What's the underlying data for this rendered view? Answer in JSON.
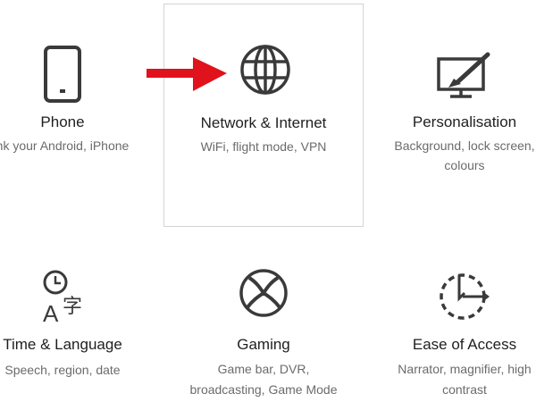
{
  "tiles": {
    "phone": {
      "title": "Phone",
      "desc": "nk your Android, iPhone",
      "icon": "phone-icon"
    },
    "network": {
      "title": "Network & Internet",
      "desc": "WiFi, flight mode, VPN",
      "icon": "globe-icon"
    },
    "personalisation": {
      "title": "Personalisation",
      "desc_line1": "Background, lock screen,",
      "desc_line2": "colours",
      "icon": "paintbrush-icon"
    },
    "time": {
      "title": "Time & Language",
      "desc": "Speech, region, date",
      "icon": "time-language-icon"
    },
    "gaming": {
      "title": "Gaming",
      "desc_line1": "Game bar, DVR,",
      "desc_line2": "broadcasting, Game Mode",
      "icon": "xbox-icon"
    },
    "ease": {
      "title": "Ease of Access",
      "desc_line1": "Narrator, magnifier, high",
      "desc_line2": "contrast",
      "icon": "ease-of-access-icon"
    }
  },
  "annotation": {
    "icon": "red-arrow-icon",
    "color": "#e0121b"
  },
  "colors": {
    "icon": "#3a3a3a",
    "title": "#1f1f1f",
    "desc": "#6b6b6b",
    "selected_border": "#d4d4d4"
  }
}
